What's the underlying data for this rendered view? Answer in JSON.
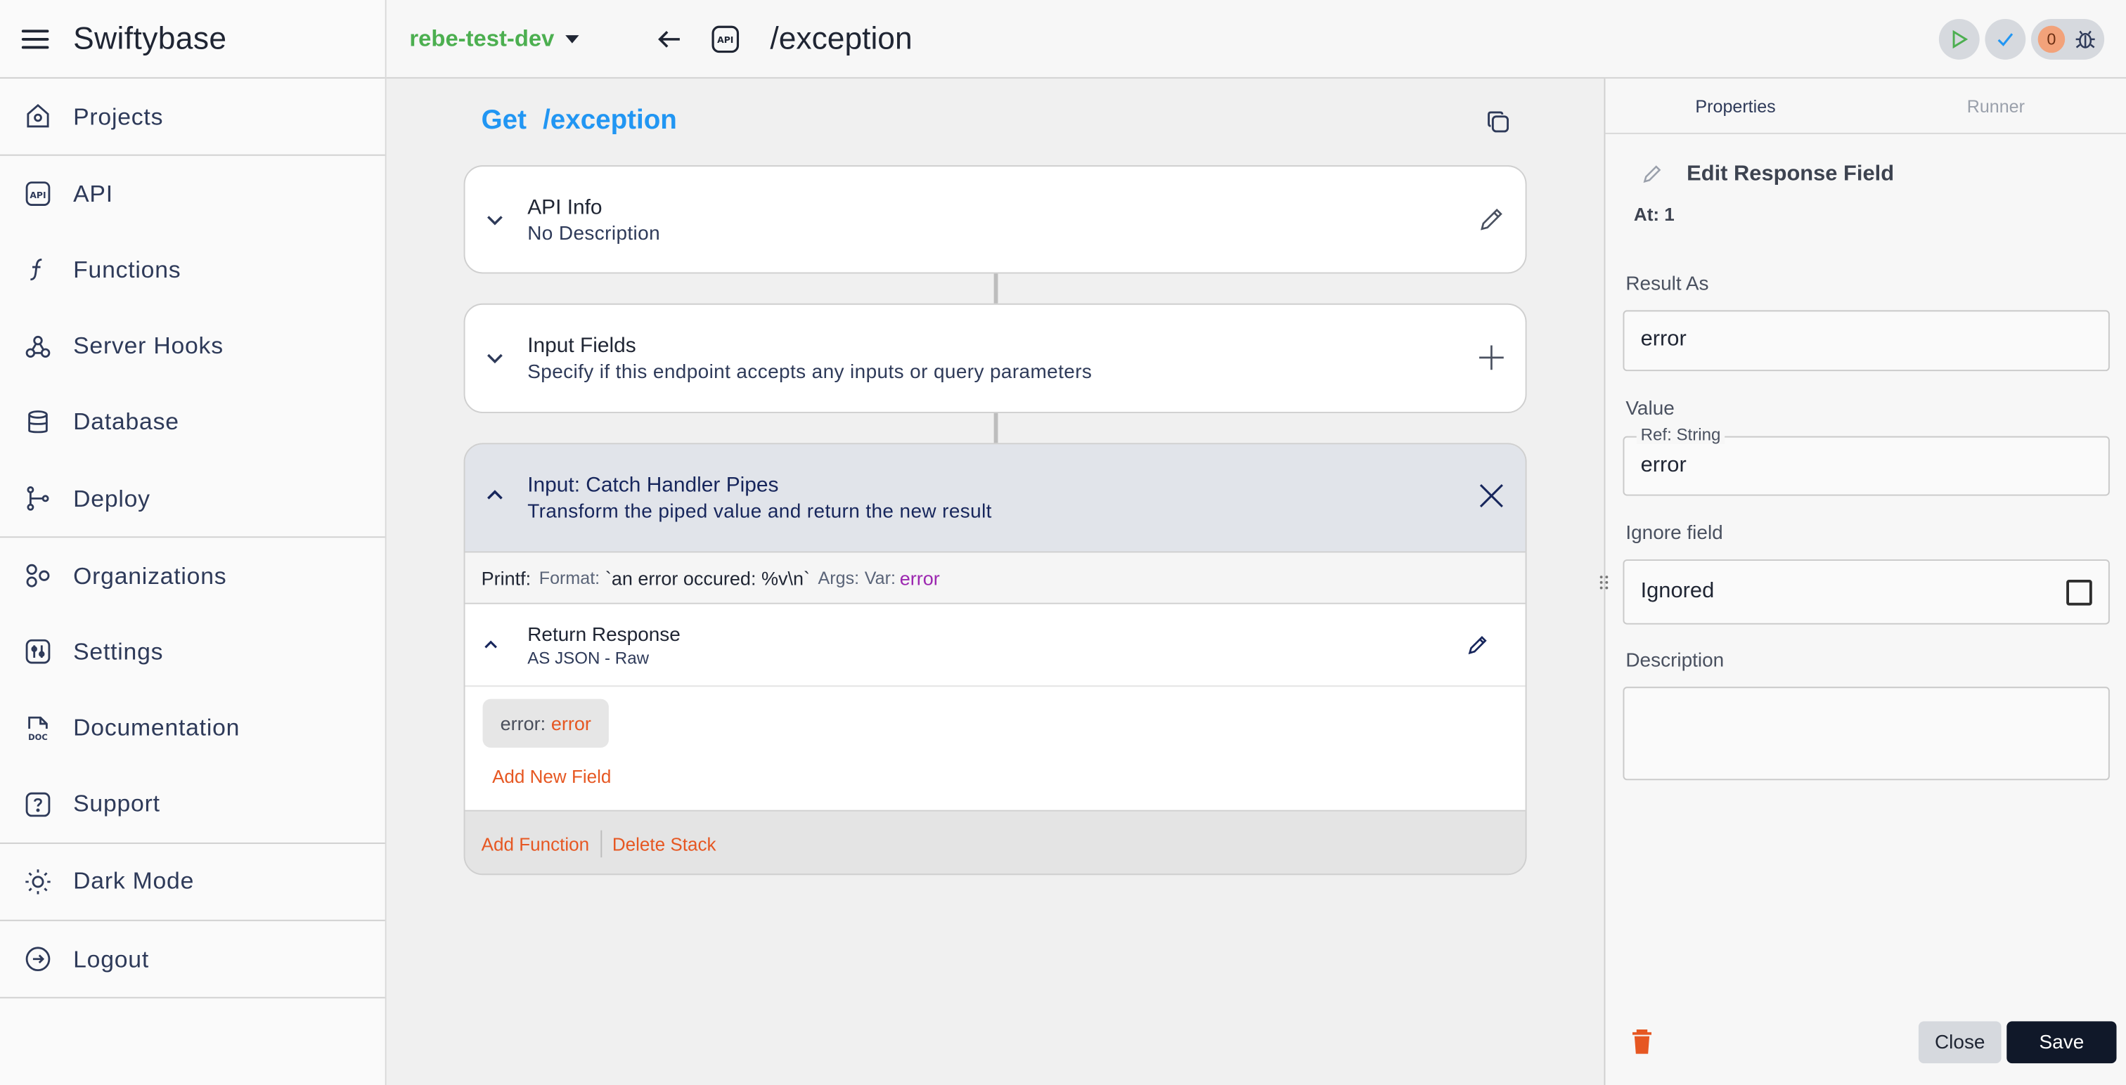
{
  "app": {
    "title": "Swiftybase"
  },
  "sidebar": {
    "items": [
      {
        "label": "Projects",
        "icon": "projects-icon"
      },
      {
        "label": "API",
        "icon": "api-icon"
      },
      {
        "label": "Functions",
        "icon": "function-icon"
      },
      {
        "label": "Server Hooks",
        "icon": "webhook-icon"
      },
      {
        "label": "Database",
        "icon": "database-icon"
      },
      {
        "label": "Deploy",
        "icon": "git-branch-icon"
      },
      {
        "label": "Organizations",
        "icon": "organizations-icon"
      },
      {
        "label": "Settings",
        "icon": "settings-icon"
      },
      {
        "label": "Documentation",
        "icon": "doc-icon"
      },
      {
        "label": "Support",
        "icon": "help-icon"
      },
      {
        "label": "Dark Mode",
        "icon": "sun-icon"
      },
      {
        "label": "Logout",
        "icon": "logout-icon"
      }
    ]
  },
  "topbar": {
    "project": "rebe-test-dev",
    "route": "/exception",
    "api_badge": "API",
    "issue_count": "0",
    "colors": {
      "project": "#4caf50",
      "run": "#4caf50",
      "check": "#2196f3"
    }
  },
  "main": {
    "method": "Get",
    "path": "/exception",
    "api_info": {
      "title": "API Info",
      "description": "No Description"
    },
    "input_fields": {
      "title": "Input Fields",
      "description": "Specify if this endpoint accepts any inputs or query parameters"
    },
    "pipe": {
      "title": "Input: Catch Handler Pipes",
      "description": "Transform the piped value and return the new result",
      "printf": {
        "name": "Printf:",
        "format_key": "Format:",
        "format_value": "`an error occured: %v\\n`",
        "args_key": "Args:",
        "var_key": "Var:",
        "var_value": "error"
      },
      "return": {
        "title": "Return Response",
        "subtitle": "AS JSON - Raw",
        "field_key": "error:",
        "field_value": "error",
        "add_field": "Add New Field"
      },
      "footer": {
        "add_function": "Add Function",
        "delete_stack": "Delete Stack"
      }
    }
  },
  "panel": {
    "tabs": [
      "Properties",
      "Runner"
    ],
    "title": "Edit Response Field",
    "at": "At: 1",
    "result_as": {
      "label": "Result As",
      "value": "error"
    },
    "value": {
      "label": "Value",
      "legend": "Ref: String",
      "value": "error"
    },
    "ignore": {
      "label": "Ignore field",
      "value": "Ignored"
    },
    "description": {
      "label": "Description",
      "value": ""
    },
    "close": "Close",
    "save": "Save"
  }
}
